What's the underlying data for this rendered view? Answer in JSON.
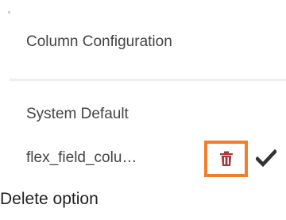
{
  "panel": {
    "title": "Column Configuration"
  },
  "options": [
    {
      "label": "System Default"
    },
    {
      "label": "flex_field_colu…"
    }
  ],
  "icons": {
    "delete": "trash-icon",
    "selected": "check-icon"
  },
  "colors": {
    "highlight": "#f07e2e",
    "trash": "#a33b3b",
    "check": "#333333"
  },
  "caption": "Delete option"
}
